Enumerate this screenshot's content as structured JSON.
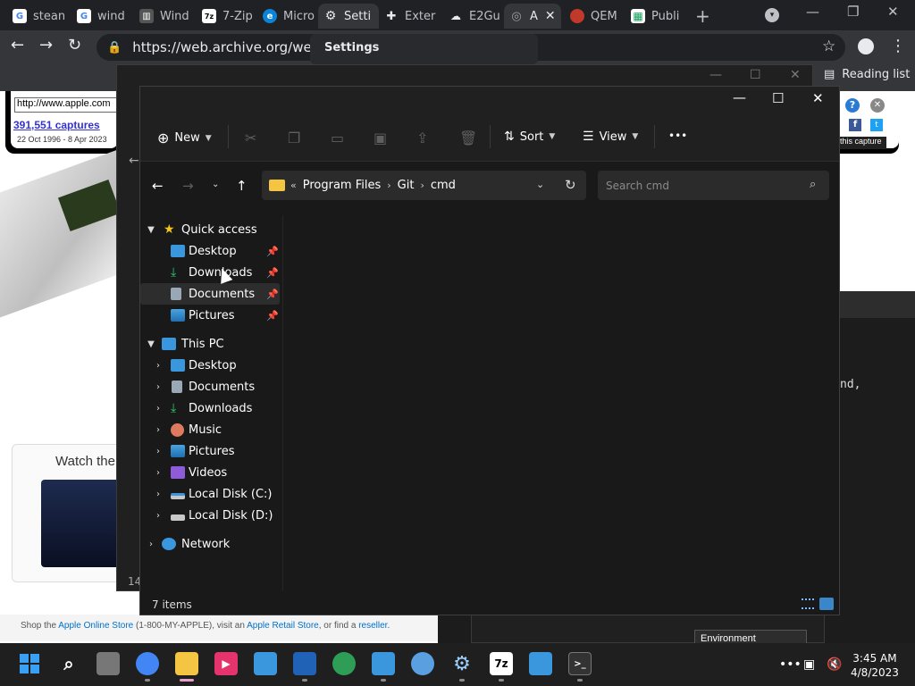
{
  "browser": {
    "tabs": [
      {
        "label": "stean",
        "fav": "G",
        "color": "#4285f4"
      },
      {
        "label": "wind",
        "fav": "G",
        "color": "#4285f4"
      },
      {
        "label": "Wind",
        "fav": "▥",
        "color": "#555555"
      },
      {
        "label": "7-Zip",
        "fav": "7z",
        "color": "#222222"
      },
      {
        "label": "Micro",
        "fav": "e",
        "color": "#0b84d8"
      },
      {
        "label": "Setti",
        "fav": "⚙",
        "color": "#35363a"
      },
      {
        "label": "Exter",
        "fav": "✚",
        "color": "#35363a"
      },
      {
        "label": "E2Gu",
        "fav": "☁",
        "color": "#222222"
      },
      {
        "label": "A",
        "fav": "◎",
        "color": "#555555"
      },
      {
        "label": "QEM",
        "fav": "●",
        "color": "#c0392b"
      },
      {
        "label": "Publi",
        "fav": "▦",
        "color": "#0f9d58"
      }
    ],
    "url": "https://web.archive.org/web/20",
    "reading_list": "Reading list",
    "settings_popup": "Settings"
  },
  "webpage": {
    "wayback_url": "http://www.apple.com",
    "captures": "391,551 captures",
    "dates": "22 Oct 1996 - 8 Apr 2023",
    "this_capture": "this capture",
    "watch_title": "Watch the",
    "footer_prefix": "Shop the ",
    "footer_store": "Apple Online Store",
    "footer_phone": " (1-800-MY-APPLE), visit an ",
    "footer_retail": "Apple Retail Store",
    "footer_find": ", or find a ",
    "footer_reseller": "reseller",
    "footer_end": ".",
    "terminal_text": "nd,",
    "env_button": "Environment Variables..."
  },
  "back_window": {
    "status_number": "14"
  },
  "explorer": {
    "commands": {
      "new": "New",
      "sort": "Sort",
      "view": "View",
      "more": "•••"
    },
    "breadcrumb": [
      "Program Files",
      "Git",
      "cmd"
    ],
    "search_placeholder": "Search cmd",
    "nav": {
      "quick_access": {
        "label": "Quick access",
        "items": [
          {
            "label": "Desktop",
            "icon": "desktop-icon",
            "pinned": true
          },
          {
            "label": "Downloads",
            "icon": "downloads-icon",
            "pinned": true
          },
          {
            "label": "Documents",
            "icon": "documents-icon",
            "pinned": true
          },
          {
            "label": "Pictures",
            "icon": "pictures-icon",
            "pinned": true
          }
        ]
      },
      "this_pc": {
        "label": "This PC",
        "items": [
          {
            "label": "Desktop",
            "icon": "desktop-icon"
          },
          {
            "label": "Documents",
            "icon": "documents-icon"
          },
          {
            "label": "Downloads",
            "icon": "downloads-icon"
          },
          {
            "label": "Music",
            "icon": "music-icon"
          },
          {
            "label": "Pictures",
            "icon": "pictures-icon"
          },
          {
            "label": "Videos",
            "icon": "videos-icon"
          },
          {
            "label": "Local Disk (C:)",
            "icon": "drive-c-icon"
          },
          {
            "label": "Local Disk (D:)",
            "icon": "drive-d-icon"
          }
        ]
      },
      "network": "Network"
    },
    "status": "7 items"
  },
  "taskbar": {
    "apps": [
      "start-icon",
      "search-icon",
      "task-view-icon",
      "chrome-icon",
      "file-explorer-icon",
      "media-icon",
      "store-icon",
      "virtualbox-icon",
      "network-app-icon",
      "remote-desktop-icon",
      "globe-icon",
      "settings-icon",
      "7zip-icon",
      "display-icon",
      "terminal-icon"
    ],
    "time": "3:45 AM",
    "date": "4/8/2023"
  }
}
